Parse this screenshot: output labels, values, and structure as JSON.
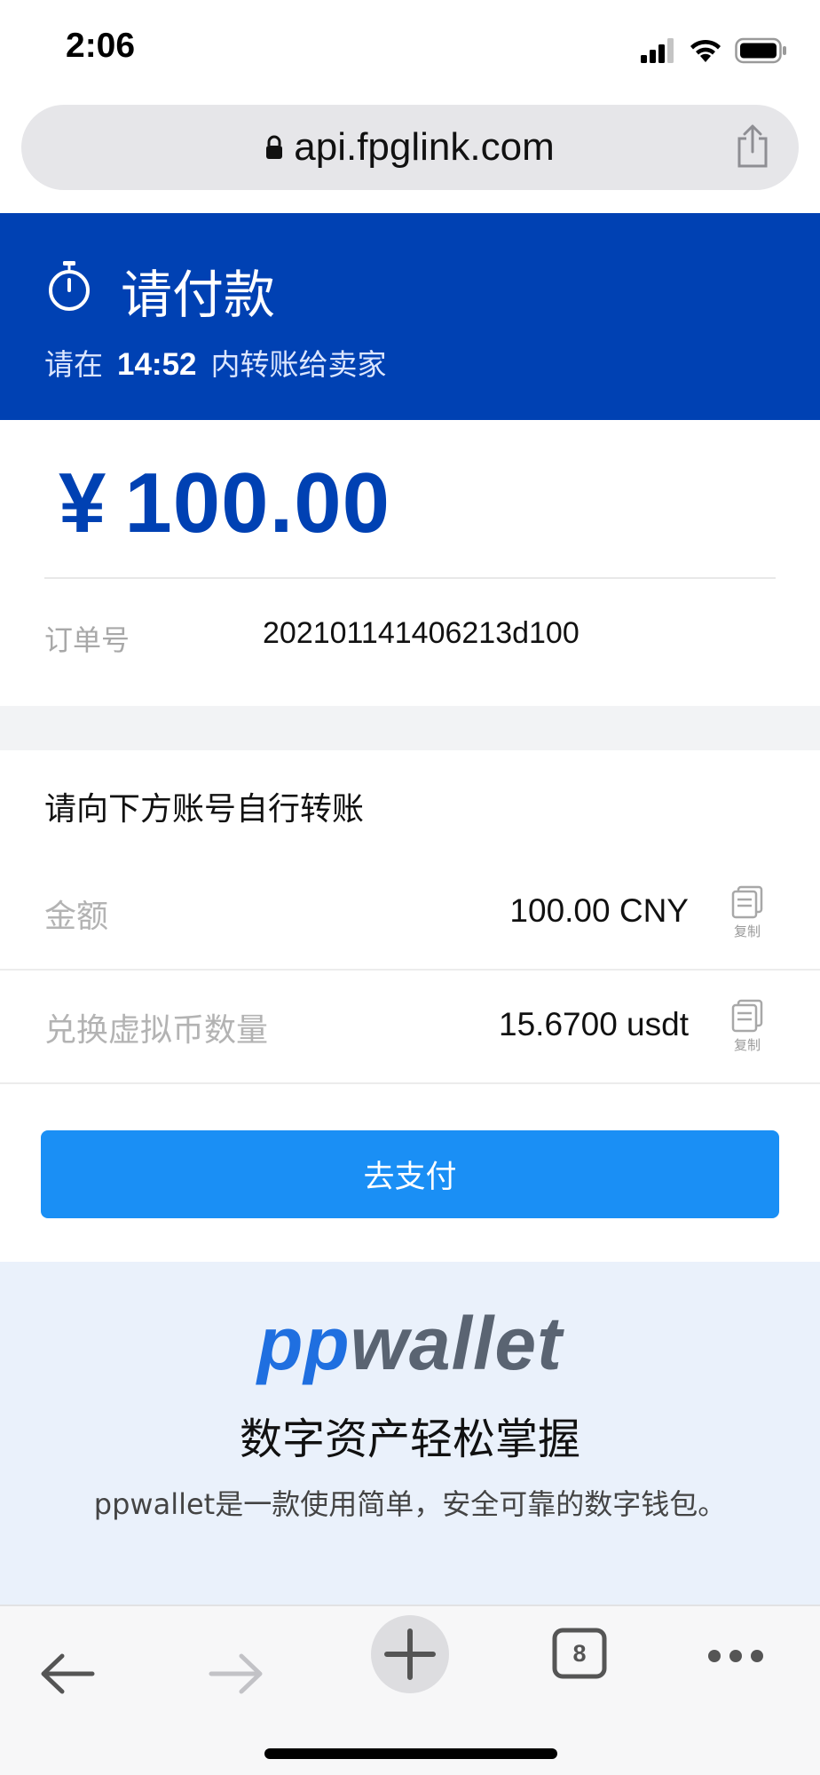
{
  "status_bar": {
    "time": "2:06"
  },
  "browser": {
    "url": "api.fpglink.com",
    "open_tabs_count": "8"
  },
  "header": {
    "title": "请付款",
    "countdown_prefix": "请在",
    "countdown_time": "14:52",
    "countdown_suffix": "内转账给卖家",
    "background_color": "#0041b3"
  },
  "order": {
    "currency_symbol": "¥",
    "amount": "100.00",
    "order_no_label": "订单号",
    "order_no_value": "202101141406213d100"
  },
  "transfer": {
    "section_title": "请向下方账号自行转账",
    "rows": [
      {
        "label": "金额",
        "value": "100.00 CNY",
        "copy_label": "复制"
      },
      {
        "label": "兑换虚拟币数量",
        "value": "15.6700 usdt",
        "copy_label": "复制"
      }
    ],
    "go_pay_label": "去支付",
    "button_color": "#1a8ff5"
  },
  "promo": {
    "logo_part1": "pp",
    "logo_part2": "wallet",
    "title": "数字资产轻松掌握",
    "description": "ppwallet是一款使用简单，安全可靠的数字钱包。",
    "background_color": "#eaf1fb"
  },
  "icons": {
    "status": [
      "cellular-signal-icon",
      "wifi-icon",
      "battery-icon"
    ],
    "url_bar": [
      "lock-icon",
      "share-icon"
    ],
    "header": [
      "stopwatch-icon"
    ],
    "rows": [
      "copy-icon"
    ],
    "toolbar": [
      "back-arrow-icon",
      "forward-arrow-icon",
      "plus-icon",
      "tabs-icon",
      "more-dots-icon"
    ]
  }
}
